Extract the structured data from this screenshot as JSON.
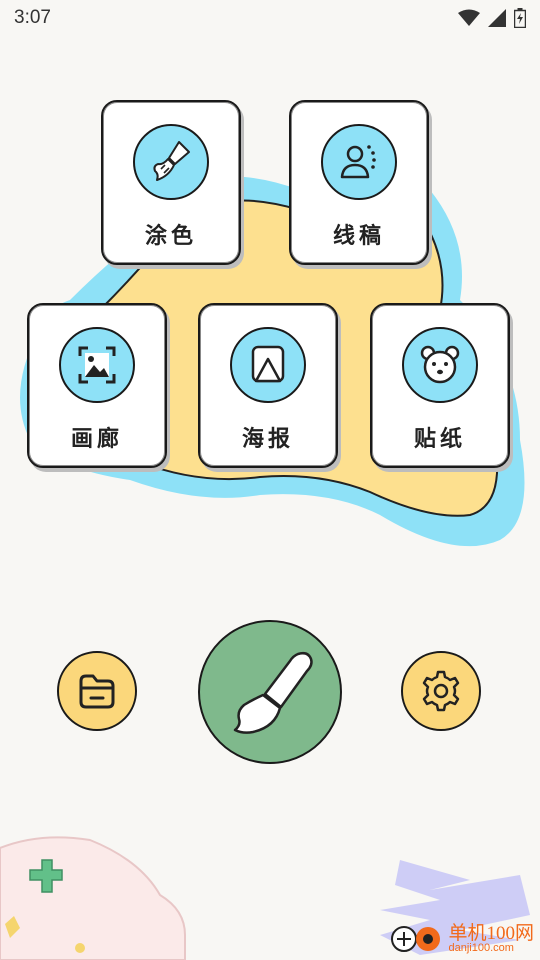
{
  "status_bar": {
    "time": "3:07"
  },
  "cards": [
    {
      "label": "涂色",
      "icon": "paint-brush-icon"
    },
    {
      "label": "线稿",
      "icon": "line-art-person-icon"
    },
    {
      "label": "画廊",
      "icon": "gallery-image-icon"
    },
    {
      "label": "海报",
      "icon": "poster-icon"
    },
    {
      "label": "贴纸",
      "icon": "bear-sticker-icon"
    }
  ],
  "bottom_bar": {
    "left_icon": "folder-icon",
    "center_icon": "brush-icon",
    "right_icon": "gear-icon"
  },
  "watermark": {
    "name": "单机100网",
    "url": "danji100.com"
  },
  "colors": {
    "background": "#f8f7f4",
    "icon_circle": "#8ee1f7",
    "blob_yellow": "#fde08f",
    "blob_blue": "#8ee1f7",
    "yellow_button": "#fbd77b",
    "green_button": "#7fb98c"
  }
}
